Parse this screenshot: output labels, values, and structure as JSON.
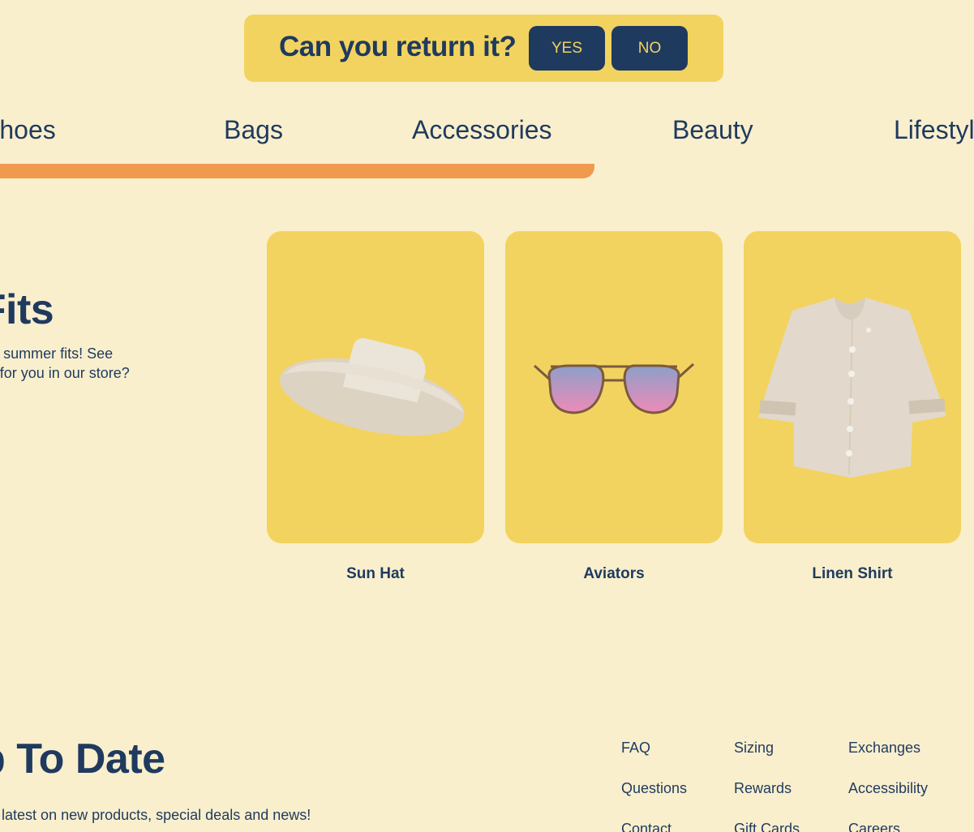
{
  "banner": {
    "question": "Can you return it?",
    "yes_label": "YES",
    "no_label": "NO"
  },
  "nav": {
    "items": [
      "Shoes",
      "Bags",
      "Accessories",
      "Beauty",
      "Lifestyle"
    ]
  },
  "hero": {
    "title": "Fun Fits",
    "description": "Grab those fun summer fits! See what’s in store for you in our store?"
  },
  "products": [
    {
      "name": "Sun Hat",
      "icon": "sun-hat-icon"
    },
    {
      "name": "Aviators",
      "icon": "aviators-icon"
    },
    {
      "name": "Linen Shirt",
      "icon": "linen-shirt-icon"
    }
  ],
  "footer": {
    "title": "Up To Date",
    "subtitle": "Get the latest on new products, special deals and news!",
    "links": [
      [
        "FAQ",
        "Sizing",
        "Exchanges"
      ],
      [
        "Questions",
        "Rewards",
        "Accessibility"
      ],
      [
        "Contact",
        "Gift Cards",
        "Careers"
      ]
    ]
  },
  "colors": {
    "background": "#f9efcd",
    "accent_yellow": "#f3d35f",
    "navy": "#1f3a5f",
    "underline_orange": "#ef9a4f"
  }
}
